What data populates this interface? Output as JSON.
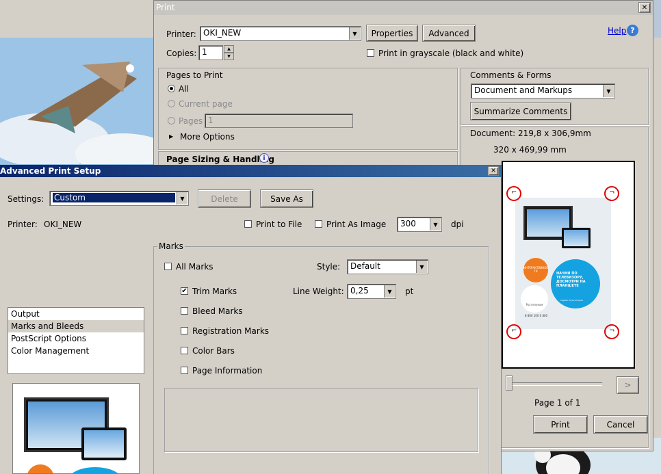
{
  "print": {
    "title": "Print",
    "close_glyph": "✕",
    "printer_label": "Printer:",
    "printer_value": "OKI_NEW",
    "properties_label": "Properties",
    "advanced_label": "Advanced",
    "help_label": "Help",
    "copies_label": "Copies:",
    "copies_value": "1",
    "grayscale_label": "Print in grayscale (black and white)",
    "pages_to_print": {
      "title": "Pages to Print",
      "all": "All",
      "current_page": "Current page",
      "pages": "Pages",
      "pages_value": "1",
      "more_options": "More Options"
    },
    "page_sizing_title": "Page Sizing & Handling",
    "comments_forms": {
      "title": "Comments & Forms",
      "value": "Document and Markups",
      "summarize": "Summarize Comments"
    },
    "document_size": "Document: 219,8 x 306,9mm",
    "preview_size": "320 x 469,99 mm",
    "page_indicator": "Page 1 of 1",
    "next_glyph": ">",
    "print_button": "Print",
    "cancel_button": "Cancel"
  },
  "advanced": {
    "title": "Advanced Print Setup",
    "close_glyph": "✕",
    "settings_label": "Settings:",
    "settings_value": "Custom",
    "delete_label": "Delete",
    "save_as_label": "Save As",
    "printer_label": "Printer:",
    "printer_value": "OKI_NEW",
    "print_to_file": "Print to File",
    "print_as_image": "Print As Image",
    "dpi_value": "300",
    "dpi_unit": "dpi",
    "categories": [
      "Output",
      "Marks and Bleeds",
      "PostScript Options",
      "Color Management"
    ],
    "marks": {
      "title": "Marks",
      "all_marks": "All Marks",
      "style_label": "Style:",
      "style_value": "Default",
      "trim_marks": "Trim Marks",
      "line_weight_label": "Line Weight:",
      "line_weight_value": "0,25",
      "line_weight_unit": "pt",
      "bleed_marks": "Bleed Marks",
      "registration_marks": "Registration Marks",
      "color_bars": "Color Bars",
      "page_information": "Page Information"
    }
  },
  "poster_text": {
    "badge": "ИНТЕРАКТИВНОЕ ТВ",
    "headline": "НАЧНИ ПО ТЕЛЕВИЗОРУ, ДОСМОТРИ НА ПЛАНШЕТЕ",
    "brand": "Ростелеком",
    "service": "Сервис Мультискрин",
    "phone": "8 800 100 0 800"
  },
  "icons": {
    "check": "✔",
    "triangle_down": "▼",
    "triangle_right": "▶",
    "info": "i",
    "help": "?"
  },
  "colors": {
    "blue_title": "#0a246a",
    "dialog_bg": "#d4d0c8",
    "mark_circle": "#e00000",
    "selected_item": "#0a246a"
  }
}
